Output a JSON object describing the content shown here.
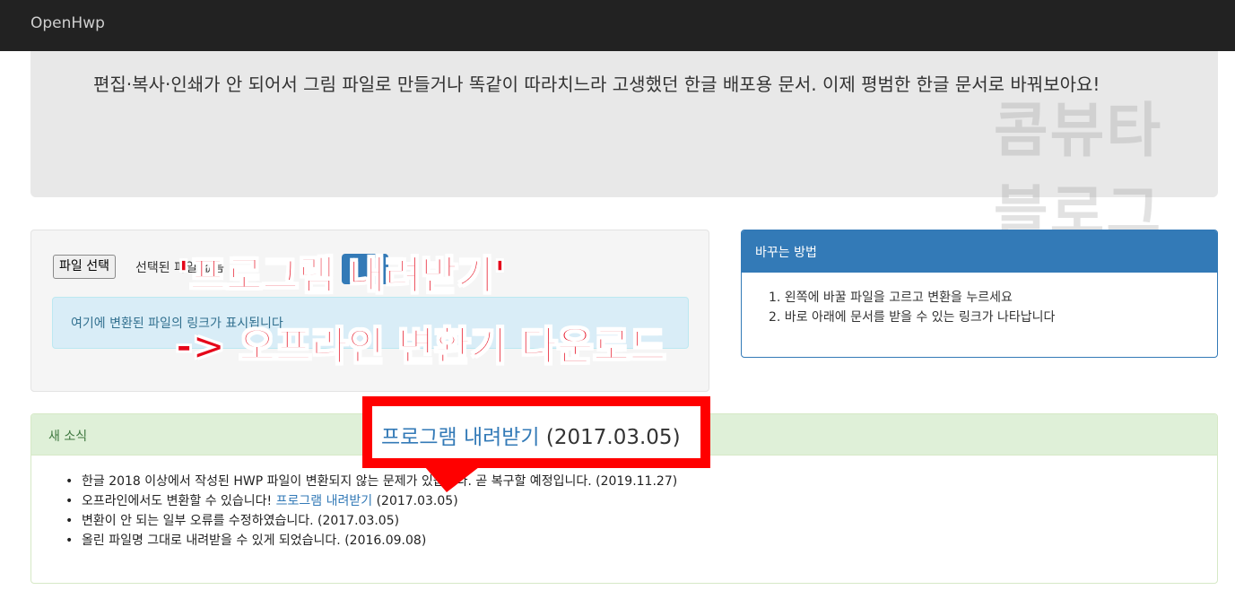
{
  "navbar": {
    "brand": "OpenHwp"
  },
  "jumbotron": {
    "text": "편집·복사·인쇄가 안 되어서 그림 파일로 만들거나 똑같이 따라치느라 고생했던 한글 배포용 문서. 이제 평범한 한글 문서로 바꿔보아요!"
  },
  "watermark": {
    "line1": "콤뷰타",
    "line2": "블로그"
  },
  "upload": {
    "file_button": "파일 선택",
    "file_status": "선택된 파일 없음",
    "info_text": "여기에 변환된 파일의 링크가 표시됩니다"
  },
  "howto": {
    "title": "바꾸는 방법",
    "steps": [
      "1. 왼쪽에 바꿀 파일을 고르고 변환을 누르세요",
      "2. 바로 아래에 문서를 받을 수 있는 링크가 나타납니다"
    ]
  },
  "news": {
    "title": "새 소식",
    "items": [
      {
        "text": "한글 2018 이상에서 작성된 HWP 파일이 변환되지 않는 문제가 있습니다. 곧 복구할 예정입니다. (2019.11.27)"
      },
      {
        "text": "오프라인에서도 변환할 수 있습니다! ",
        "link": "프로그램 내려받기",
        "suffix": " (2017.03.05)"
      },
      {
        "text": "변환이 안 되는 일부 오류를 수정하였습니다. (2017.03.05)"
      },
      {
        "text": "올린 파일명 그대로 내려받을 수 있게 되었습니다. (2016.09.08)"
      }
    ]
  },
  "annotation": {
    "line1": "'프로그램 내려받기'",
    "line2": "-> 오프라인 변환기 다운로드",
    "callout_link": "프로그램 내려받기",
    "callout_date": " (2017.03.05)",
    "color": "#e5071a"
  },
  "colors": {
    "navbar": "#222222",
    "primary": "#337ab7",
    "info_bg": "#d9edf7",
    "success_bg": "#dff0d8",
    "highlight_red": "#ff0000"
  }
}
